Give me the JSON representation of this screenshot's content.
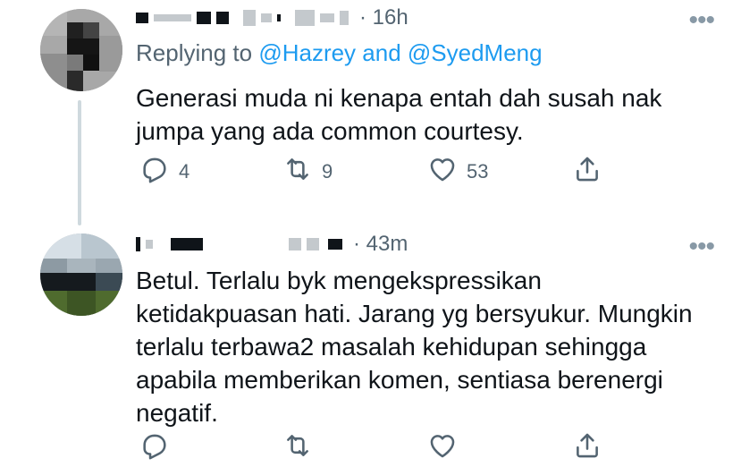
{
  "tweets": [
    {
      "time": "16h",
      "reply_prefix": "Replying to ",
      "reply_handle_1": "@Hazrey",
      "reply_and": " and ",
      "reply_handle_2": "@SyedMeng",
      "text_line_1": "Generasi muda ni kenapa entah dah susah nak",
      "text_line_2": "jumpa yang ada common courtesy.",
      "more": "•••",
      "actions": {
        "replies": "4",
        "retweets": "9",
        "likes": "53"
      }
    },
    {
      "time": "43m",
      "text_line_1": "Betul. Terlalu byk mengekspressikan",
      "text_line_2": "ketidakpuasan hati. Jarang yg bersyukur. Mungkin",
      "text_line_3": "terlalu terbawa2 masalah kehidupan sehingga",
      "text_line_4": "apabila memberikan komen, sentiasa berenergi",
      "text_line_5": "negatif.",
      "more": "•••",
      "actions": {
        "replies": "",
        "retweets": "",
        "likes": ""
      }
    }
  ],
  "icons": {
    "reply": "reply-icon",
    "retweet": "retweet-icon",
    "like": "heart-icon",
    "share": "share-icon"
  }
}
